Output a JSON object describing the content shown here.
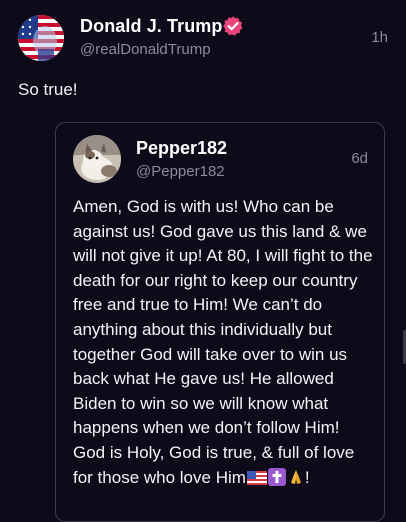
{
  "post": {
    "author_name": "Donald J. Trump",
    "author_handle": "@realDonaldTrump",
    "time": "1h",
    "text": "So true!"
  },
  "quote": {
    "author_name": "Pepper182",
    "author_handle": "@Pepper182",
    "time": "6d",
    "body_text": "Amen, God is with us! Who can be against us! God gave us this land & we will not give it up! At 80, I will fight to the death for our right to keep our country free and true to Him! We can’t do anything about this individually but together God will take over to win us back what He gave us! He allowed Biden to win so we will know what happens when we don’t follow Him! God is Holy, God is true, & full of love for those who love Him",
    "body_suffix": "!",
    "emojis": [
      "us-flag-icon",
      "latin-cross-icon",
      "folded-hands-icon"
    ]
  },
  "colors": {
    "background": "#0d0a1a",
    "secondary_text": "#8d8a9c",
    "verified_badge": "#e8457a",
    "card_border": "#3c3848"
  }
}
